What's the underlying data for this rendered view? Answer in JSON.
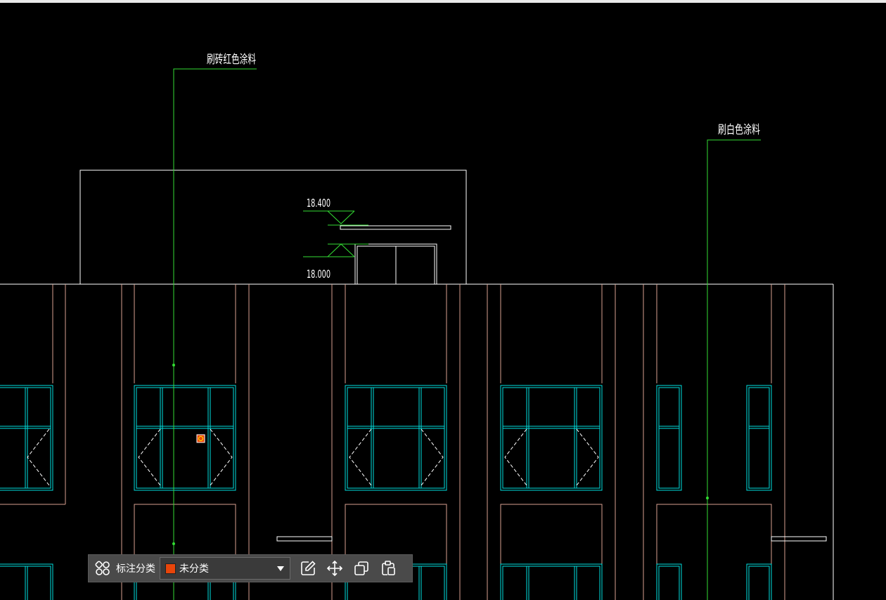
{
  "drawing": {
    "annotation_red_coating": "刷砖红色涂料",
    "annotation_white_coating": "刷白色涂料",
    "elevation_upper": "18.400",
    "elevation_lower": "18.000"
  },
  "toolbar": {
    "category_icon": "category-grid-icon",
    "category_label": "标注分类",
    "selected_category": "未分类",
    "selected_category_color": "#e8450a",
    "actions": [
      {
        "name": "edit-annotation-button",
        "icon": "edit-icon"
      },
      {
        "name": "move-annotation-button",
        "icon": "move-icon"
      },
      {
        "name": "copy-annotation-button",
        "icon": "copy-icon"
      },
      {
        "name": "paste-annotation-button",
        "icon": "paste-icon"
      }
    ]
  },
  "colors": {
    "background": "#000000",
    "leader": "#33dd33",
    "window": "#00e0e0",
    "pilaster": "#d8a090",
    "outline": "#ffffff",
    "toolbar": "#4a4a4a"
  }
}
